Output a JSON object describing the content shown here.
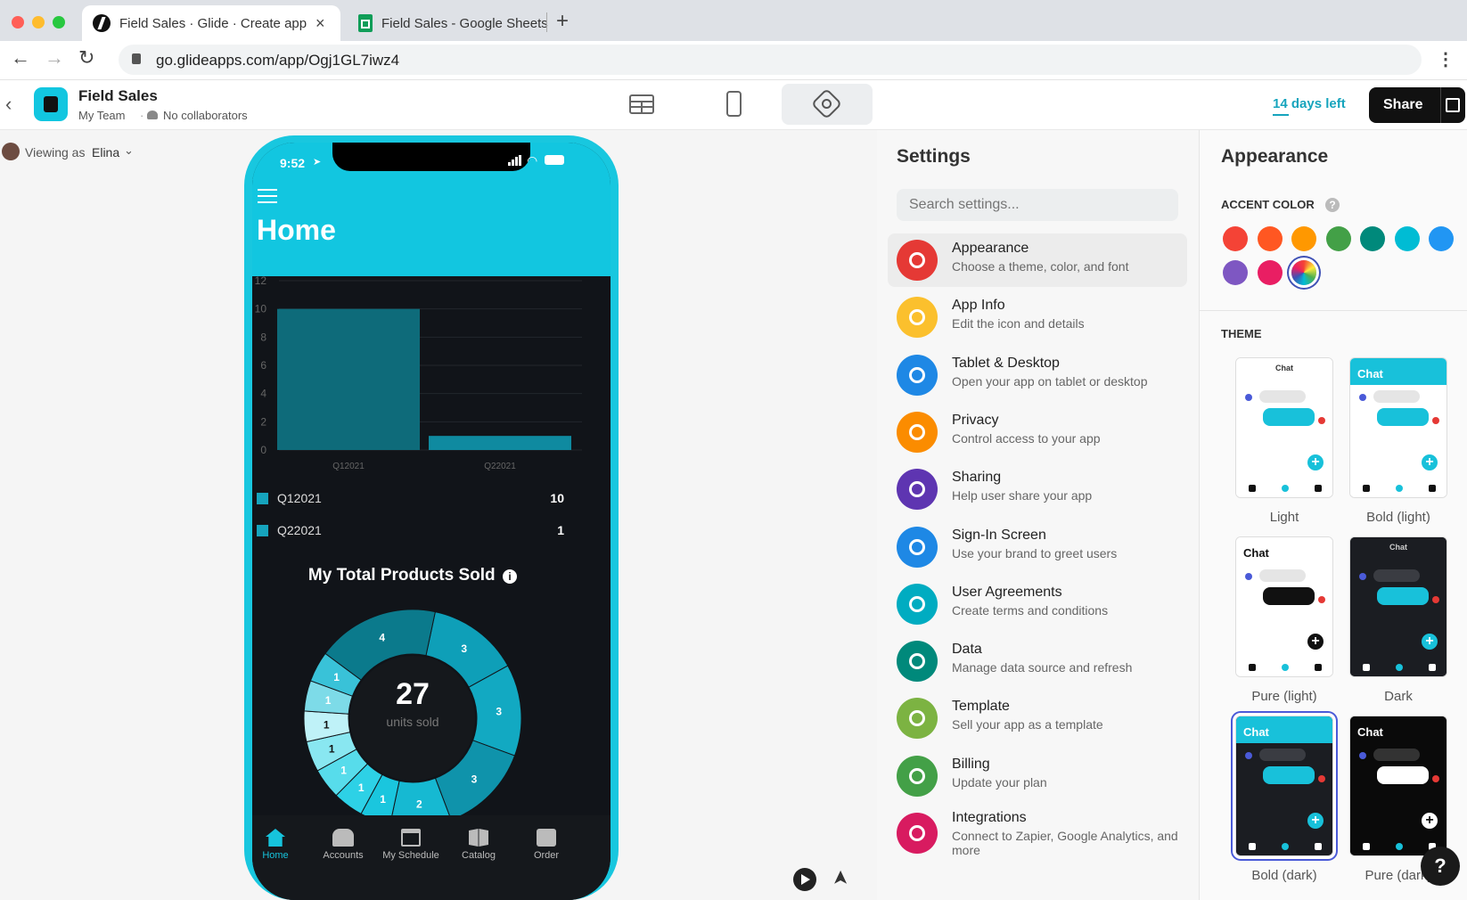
{
  "browser": {
    "tabs": [
      {
        "title": "Field Sales · Glide · Create apps",
        "icon": "glide-icon"
      },
      {
        "title": "Field Sales - Google Sheets",
        "icon": "sheets-icon"
      }
    ],
    "url": "go.glideapps.com/app/Ogj1GL7iwz4"
  },
  "header": {
    "app_name": "Field Sales",
    "team": "My Team",
    "collaborators": "No collaborators",
    "trial": "14 days left",
    "share_label": "Share"
  },
  "viewer": {
    "prefix": "Viewing as",
    "name": "Elina"
  },
  "phone": {
    "time": "9:52",
    "title": "Home",
    "legend": [
      {
        "label": "Q12021",
        "value": "10"
      },
      {
        "label": "Q22021",
        "value": "1"
      }
    ],
    "donut_title": "My Total Products Sold",
    "donut_total": "27",
    "donut_unit": "units sold",
    "nav": [
      "Home",
      "Accounts",
      "My Schedule",
      "Catalog",
      "Order"
    ]
  },
  "chart_data": [
    {
      "type": "bar",
      "categories": [
        "Q12021",
        "Q22021"
      ],
      "values": [
        10,
        1
      ],
      "ylim": [
        0,
        12
      ],
      "yticks": [
        0,
        2,
        4,
        6,
        8,
        10,
        12
      ],
      "grid": true
    },
    {
      "type": "pie",
      "values": [
        3,
        3,
        3,
        2,
        1,
        1,
        1,
        1,
        1,
        1,
        1,
        4
      ],
      "labels": [
        "3",
        "3",
        "3",
        "2",
        "1",
        "1",
        "1",
        "1",
        "1",
        "1",
        "1",
        "4"
      ]
    }
  ],
  "settings": {
    "title": "Settings",
    "search_placeholder": "Search settings...",
    "items": [
      {
        "title": "Appearance",
        "sub": "Choose a theme, color, and font",
        "color": "#e53935",
        "icon": "palette-icon"
      },
      {
        "title": "App Info",
        "sub": "Edit the icon and details",
        "color": "#fbc02d",
        "icon": "info-icon"
      },
      {
        "title": "Tablet & Desktop",
        "sub": "Open your app on tablet or desktop",
        "color": "#1e88e5",
        "icon": "tablet-icon"
      },
      {
        "title": "Privacy",
        "sub": "Control access to your app",
        "color": "#fb8c00",
        "icon": "lock-icon"
      },
      {
        "title": "Sharing",
        "sub": "Help user share your app",
        "color": "#5e35b1",
        "icon": "share-icon"
      },
      {
        "title": "Sign-In Screen",
        "sub": "Use your brand to greet users",
        "color": "#1e88e5",
        "icon": "signin-icon"
      },
      {
        "title": "User Agreements",
        "sub": "Create terms and conditions",
        "color": "#00acc1",
        "icon": "check-icon"
      },
      {
        "title": "Data",
        "sub": "Manage data source and refresh",
        "color": "#00897b",
        "icon": "sync-icon"
      },
      {
        "title": "Template",
        "sub": "Sell your app as a template",
        "color": "#7cb342",
        "icon": "store-icon"
      },
      {
        "title": "Billing",
        "sub": "Update your plan",
        "color": "#43a047",
        "icon": "billing-icon"
      },
      {
        "title": "Integrations",
        "sub": "Connect to Zapier, Google Analytics, and more",
        "color": "#d81b60",
        "icon": "puzzle-icon"
      }
    ]
  },
  "appearance": {
    "title": "Appearance",
    "accent_label": "ACCENT COLOR",
    "accent_colors": [
      "#f44336",
      "#ff5722",
      "#ff9800",
      "#43a047",
      "#00897b",
      "#00bcd4",
      "#2196f3",
      "#7e57c2",
      "#e91e63",
      "custom"
    ],
    "theme_label": "THEME",
    "themes": [
      {
        "label": "Light",
        "card_title": "Chat"
      },
      {
        "label": "Bold (light)",
        "card_title": "Chat"
      },
      {
        "label": "Pure (light)",
        "card_title": "Chat"
      },
      {
        "label": "Dark",
        "card_title": "Chat"
      },
      {
        "label": "Bold (dark)",
        "card_title": "Chat"
      },
      {
        "label": "Pure (dark)",
        "card_title": "Chat"
      }
    ]
  }
}
